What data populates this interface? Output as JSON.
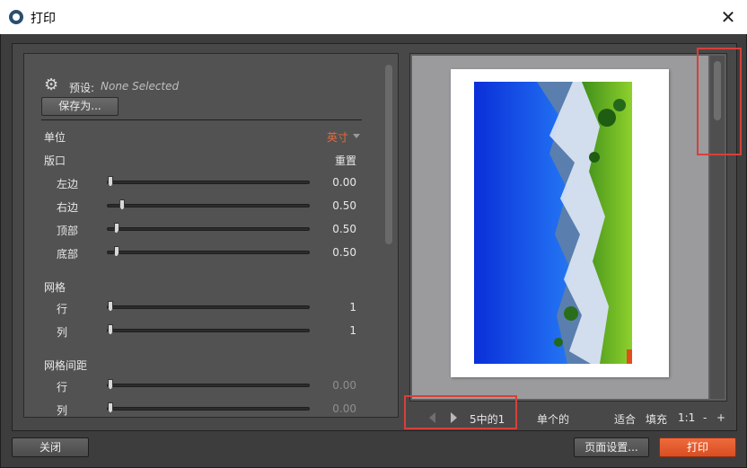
{
  "window": {
    "title": "打印",
    "close_glyph": "✕"
  },
  "presets": {
    "label": "预设:",
    "value": "None Selected",
    "save_as_label": "保存为..."
  },
  "units": {
    "label": "单位",
    "value": "英寸"
  },
  "margins": {
    "label": "版口",
    "reset_label": "重置",
    "items": [
      {
        "label": "左边",
        "value": "0.00",
        "fraction": 0.0
      },
      {
        "label": "右边",
        "value": "0.50",
        "fraction": 0.06
      },
      {
        "label": "顶部",
        "value": "0.50",
        "fraction": 0.03
      },
      {
        "label": "底部",
        "value": "0.50",
        "fraction": 0.03
      }
    ]
  },
  "grid": {
    "label": "网格",
    "items": [
      {
        "label": "行",
        "value": "1",
        "fraction": 0.0
      },
      {
        "label": "列",
        "value": "1",
        "fraction": 0.0
      }
    ]
  },
  "grid_spacing": {
    "label": "网格间距",
    "items": [
      {
        "label": "行",
        "value": "0.00",
        "fraction": 0.0
      },
      {
        "label": "列",
        "value": "0.00",
        "fraction": 0.0
      }
    ]
  },
  "preview_toolbar": {
    "page_indicator": "5中的1",
    "layout_mode": "单个的",
    "fit_label": "适合",
    "fill_label": "填充",
    "zoom_actual": "1:1",
    "zoom_out": "-",
    "zoom_in": "+"
  },
  "buttons": {
    "close": "关闭",
    "page_setup": "页面设置...",
    "print": "打印"
  },
  "colors": {
    "accent": "#e7693b",
    "highlight_box": "#d6403a"
  }
}
